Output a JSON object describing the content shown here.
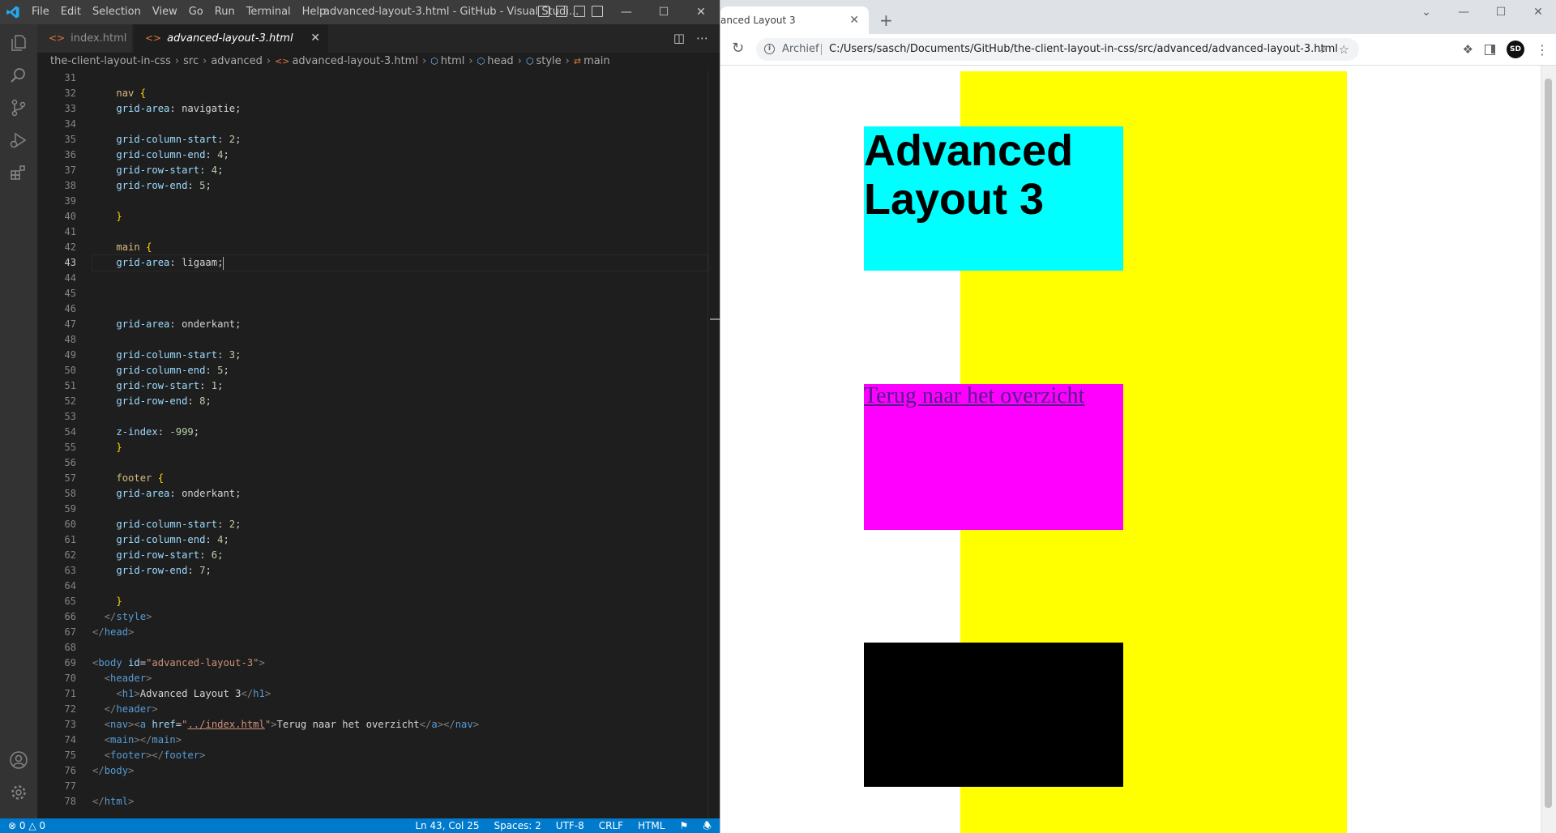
{
  "vscode": {
    "menu": [
      "File",
      "Edit",
      "Selection",
      "View",
      "Go",
      "Run",
      "Terminal",
      "Help"
    ],
    "window_title": "advanced-layout-3.html - GitHub - Visual Studi...",
    "tabs": [
      {
        "label": "index.html",
        "active": false
      },
      {
        "label": "advanced-layout-3.html",
        "active": true
      }
    ],
    "breadcrumb": [
      "the-client-layout-in-css",
      "src",
      "advanced",
      "advanced-layout-3.html",
      "html",
      "head",
      "style",
      "main"
    ],
    "cursor_line": 43,
    "status": {
      "problems": "0",
      "warnings": "0",
      "position": "Ln 43, Col 25",
      "spaces": "Spaces: 2",
      "encoding": "UTF-8",
      "eol": "CRLF",
      "language": "HTML"
    }
  },
  "chrome": {
    "tab_title": "anced Layout 3",
    "omnibox_chip": "Archief",
    "url": "C:/Users/sasch/Documents/GitHub/the-client-layout-in-css/src/advanced/advanced-layout-3.html",
    "avatar": "SD",
    "page": {
      "h1": "Advanced Layout 3",
      "nav_link": "Terug naar het overzicht"
    }
  }
}
